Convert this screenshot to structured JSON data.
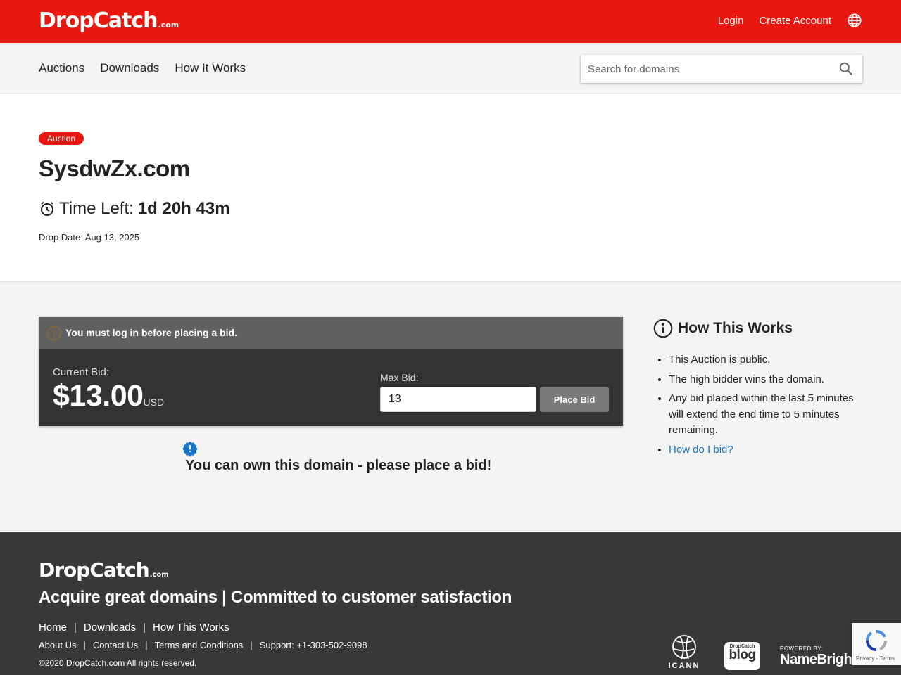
{
  "header": {
    "logo_main": "DropCatch",
    "logo_suffix": ".com",
    "login": "Login",
    "create_account": "Create Account"
  },
  "nav": {
    "items": [
      "Auctions",
      "Downloads",
      "How It Works"
    ],
    "search_placeholder": "Search for domains"
  },
  "listing": {
    "badge": "Auction",
    "domain": "SysdwZx.com",
    "time_left_label": "Time Left:",
    "time_left_value": "1d 20h 43m",
    "drop_date": "Drop Date: Aug 13, 2025"
  },
  "bid": {
    "warning": "You must log in before placing a bid.",
    "current_label": "Current Bid:",
    "current_amount": "$13.00",
    "currency": "USD",
    "max_label": "Max Bid:",
    "max_value": "13",
    "place_bid": "Place Bid",
    "own_message": "You can own this domain - please place a bid!"
  },
  "how": {
    "title": "How This Works",
    "items": [
      "This Auction is public.",
      "The high bidder wins the domain.",
      "Any bid placed within the last 5 minutes will extend the end time to 5 minutes remaining."
    ],
    "link": "How do I bid?"
  },
  "footer": {
    "logo_main": "DropCatch",
    "logo_suffix": ".com",
    "tagline": "Acquire great domains | Committed to customer satisfaction",
    "nav_primary": [
      "Home",
      "Downloads",
      "How This Works"
    ],
    "nav_secondary": [
      "About Us",
      "Contact Us",
      "Terms and Conditions",
      "Support: +1-303-502-9098"
    ],
    "copyright": "©2020 DropCatch.com All rights reserved.",
    "icann": "ICANN",
    "blog_small": "DropCatch",
    "blog_big": "blog",
    "nb_small": "POWERED BY:",
    "nb_big": "NameBright.com"
  },
  "recaptcha": {
    "links": "Privacy - Terms"
  },
  "colors": {
    "brand_red": "#e8170f",
    "link_blue": "#1a73c6",
    "panel_dark": "#333333",
    "footer_dark": "#383838"
  },
  "icons": [
    "globe-icon",
    "search-icon",
    "alarm-clock-icon",
    "warning-icon",
    "info-icon",
    "verified-badge-icon",
    "recaptcha-icon"
  ]
}
